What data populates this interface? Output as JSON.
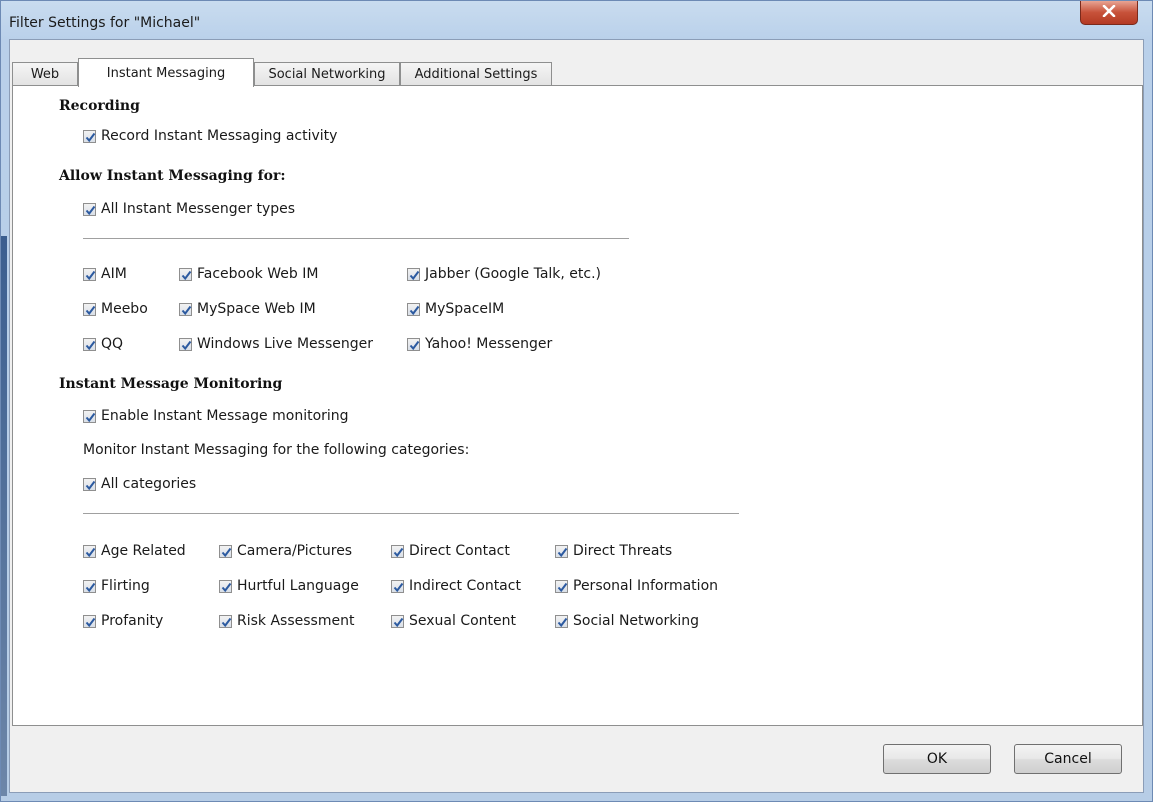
{
  "window": {
    "title": "Filter Settings for \"Michael\"",
    "close_icon": "close-x-icon"
  },
  "tabs": [
    {
      "label": "Web",
      "active": false
    },
    {
      "label": "Instant Messaging",
      "active": true
    },
    {
      "label": "Social Networking",
      "active": false
    },
    {
      "label": "Additional Settings",
      "active": false
    }
  ],
  "recording": {
    "title": "Recording",
    "record_im": {
      "label": "Record Instant Messaging activity",
      "checked": true
    }
  },
  "allow": {
    "title": "Allow Instant Messaging for:",
    "all_types": {
      "label": "All Instant Messenger types",
      "checked": true
    },
    "messengers": [
      {
        "label": "AIM",
        "checked": true
      },
      {
        "label": "Facebook Web IM",
        "checked": true
      },
      {
        "label": "Jabber (Google Talk, etc.)",
        "checked": true
      },
      {
        "label": "Meebo",
        "checked": true
      },
      {
        "label": "MySpace Web IM",
        "checked": true
      },
      {
        "label": "MySpaceIM",
        "checked": true
      },
      {
        "label": "QQ",
        "checked": true
      },
      {
        "label": "Windows Live Messenger",
        "checked": true
      },
      {
        "label": "Yahoo! Messenger",
        "checked": true
      }
    ]
  },
  "monitoring": {
    "title": "Instant Message Monitoring",
    "enable": {
      "label": "Enable Instant Message monitoring",
      "checked": true
    },
    "categories_caption": "Monitor Instant Messaging for the following categories:",
    "all_categories": {
      "label": "All categories",
      "checked": true
    },
    "categories": [
      {
        "label": "Age Related",
        "checked": true
      },
      {
        "label": "Camera/Pictures",
        "checked": true
      },
      {
        "label": "Direct Contact",
        "checked": true
      },
      {
        "label": "Direct Threats",
        "checked": true
      },
      {
        "label": "Flirting",
        "checked": true
      },
      {
        "label": "Hurtful Language",
        "checked": true
      },
      {
        "label": "Indirect Contact",
        "checked": true
      },
      {
        "label": "Personal Information",
        "checked": true
      },
      {
        "label": "Profanity",
        "checked": true
      },
      {
        "label": "Risk Assessment",
        "checked": true
      },
      {
        "label": "Sexual Content",
        "checked": true
      },
      {
        "label": "Social Networking",
        "checked": true
      }
    ]
  },
  "buttons": {
    "ok": "OK",
    "cancel": "Cancel"
  },
  "colors": {
    "checkmark": "#2c5aa0",
    "title_bar": "#b9d0ea",
    "close_button": "#c7523a"
  }
}
